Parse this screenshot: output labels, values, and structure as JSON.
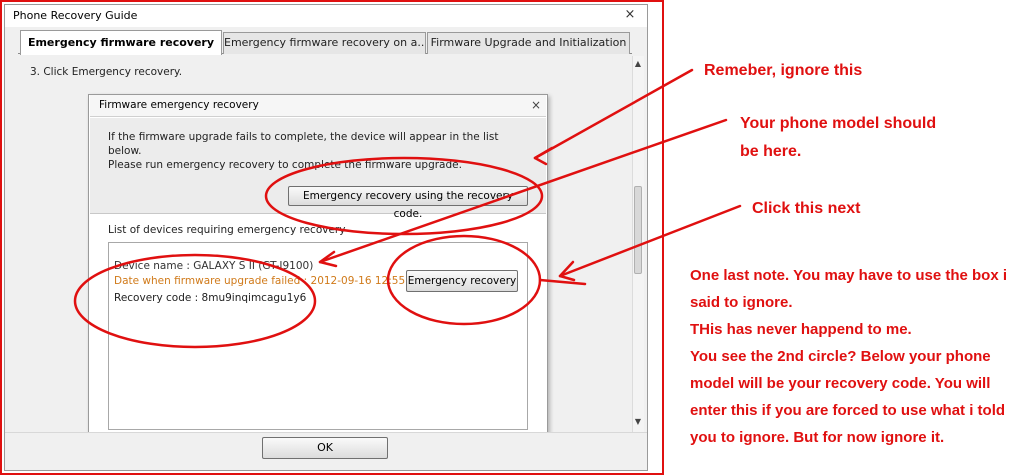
{
  "window": {
    "title": "Phone Recovery Guide",
    "close_glyph": "×",
    "tabs": [
      {
        "label": "Emergency firmware recovery",
        "active": true
      },
      {
        "label": "Emergency firmware recovery on a...",
        "active": false
      },
      {
        "label": "Firmware Upgrade and Initialization",
        "active": false
      }
    ],
    "step_text": "3.   Click Emergency recovery.",
    "ok_label": "OK"
  },
  "dialog": {
    "title": "Firmware emergency recovery",
    "close_glyph": "×",
    "info_line1": "If the firmware upgrade fails to complete, the device will appear in the list below.",
    "info_line2": "Please run emergency recovery to complete the firmware upgrade.",
    "recovery_code_button": "Emergency recovery using the recovery code.",
    "list_label": "List of devices requiring emergency recovery",
    "device": {
      "name": "Device name : GALAXY S II (GT-I9100)",
      "date": "Date when firmware upgrade failed : 2012-09-16 12:55",
      "recovery_code": "Recovery code :  8mu9inqimcagu1y6"
    },
    "emergency_button": "Emergency recovery"
  },
  "annotations": {
    "note1": "Remeber, ignore this",
    "note2_line1": "Your phone model should",
    "note2_line2": "be here.",
    "note3": "Click this next",
    "note4_lines": [
      "One last note. You may have to use the box i",
      "said to ignore.",
      "THis has never happend to me.",
      "You see the 2nd circle? Below your phone",
      "model will be your recovery code. You will",
      "enter this if you are forced to use what i told",
      "you to ignore. But for now ignore it."
    ]
  },
  "colors": {
    "annotation": "#e01010",
    "date_text": "#d07a1a"
  },
  "icons": {
    "close": "close-icon",
    "scroll_up": "scroll-up-icon",
    "scroll_down": "scroll-down-icon"
  }
}
